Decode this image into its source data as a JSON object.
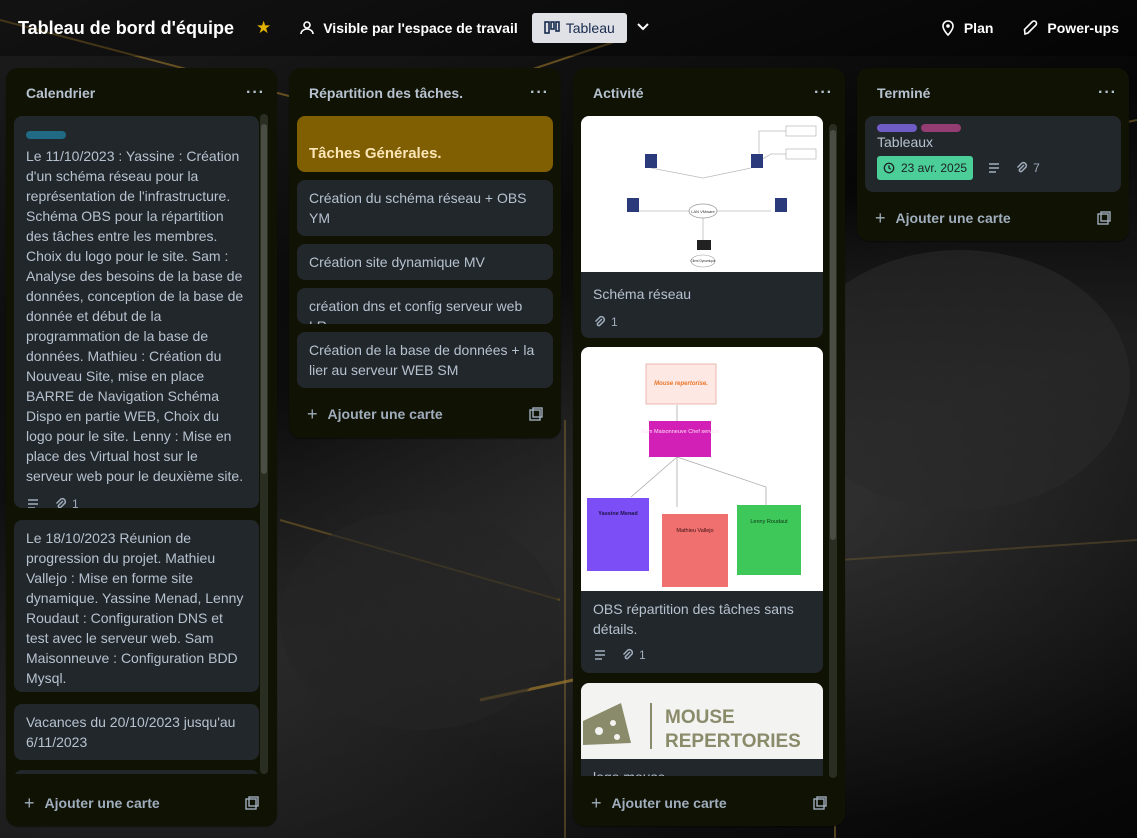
{
  "header": {
    "board_title": "Tableau de bord d'équipe",
    "visibility_label": "Visible par l'espace de travail",
    "view_label": "Tableau",
    "plan_label": "Plan",
    "powerups_label": "Power-ups"
  },
  "colors": {
    "list_bg": "#101204",
    "card_bg": "#22272b",
    "star": "#e2b203",
    "date_badge": "#4bce97",
    "section_card": "#7f5f01",
    "label_teal": "#206a83",
    "label_purple": "#6e5dc6",
    "label_magenta": "#943d73"
  },
  "lists": {
    "calendrier": {
      "title": "Calendrier",
      "add_card": "Ajouter une carte",
      "cards": [
        {
          "text": "Le 11/10/2023 : Yassine : Création d'un schéma réseau pour la représentation de l'infrastructure. Schéma OBS pour la répartition des tâches entre les membres. Choix du logo pour le site. Sam : Analyse des besoins de la base de données, conception de la base de donnée et début de la programmation de la base de données. Mathieu : Création du Nouveau Site, mise en place BARRE de Navigation Schéma Dispo en partie WEB, Choix du logo pour le site. Lenny : Mise en place des Virtual host sur le serveur web pour le deuxième site.",
          "attachments": "1"
        },
        {
          "text": "Le 18/10/2023 Réunion de progression du projet. Mathieu Vallejo : Mise en forme site dynamique. Yassine Menad, Lenny Roudaut : Configuration DNS et test avec le serveur web. Sam Maisonneuve : Configuration BDD Mysql."
        },
        {
          "text": "Vacances du 20/10/2023 jusqu'au 6/11/2023"
        }
      ]
    },
    "repartition": {
      "title": "Répartition des tâches.",
      "add_card": "Ajouter une carte",
      "section_title": "Tâches Générales.",
      "cards": [
        "Création du schéma réseau + OBS YM",
        "Création site dynamique MV",
        "création dns et config serveur web LR",
        "Création de la base de données + la lier au serveur WEB SM"
      ]
    },
    "activite": {
      "title": "Activité",
      "add_card": "Ajouter une carte",
      "cards": [
        {
          "title": "Schéma réseau",
          "attachments": "1",
          "cover_labels": [
            "LAN VMware",
            "Client Dynamique"
          ]
        },
        {
          "title": "OBS répartition des tâches sans détails.",
          "attachments": "1",
          "cover_labels": {
            "top": "Mouse repertorise.",
            "middle": "Sam Maisonneuve Chef service",
            "left": "Yassine Menad",
            "center": "Mathieu Vallejo",
            "right": "Lenny Roudaut"
          }
        },
        {
          "title": "logo mouse",
          "logo_text": [
            "MOUSE",
            "REPERTORIES"
          ]
        }
      ]
    },
    "termine": {
      "title": "Terminé",
      "add_card": "Ajouter une carte",
      "cards": [
        {
          "title": "Tableaux",
          "date": "23 avr. 2025",
          "attachments": "7"
        }
      ]
    }
  },
  "icons": {
    "star": "star-icon",
    "visibility": "people-icon",
    "view": "board-icon",
    "plan": "location-pin-icon",
    "powerups": "rocket-icon",
    "description": "description-icon",
    "attachment": "paperclip-icon",
    "clock": "clock-icon",
    "template": "template-icon"
  }
}
